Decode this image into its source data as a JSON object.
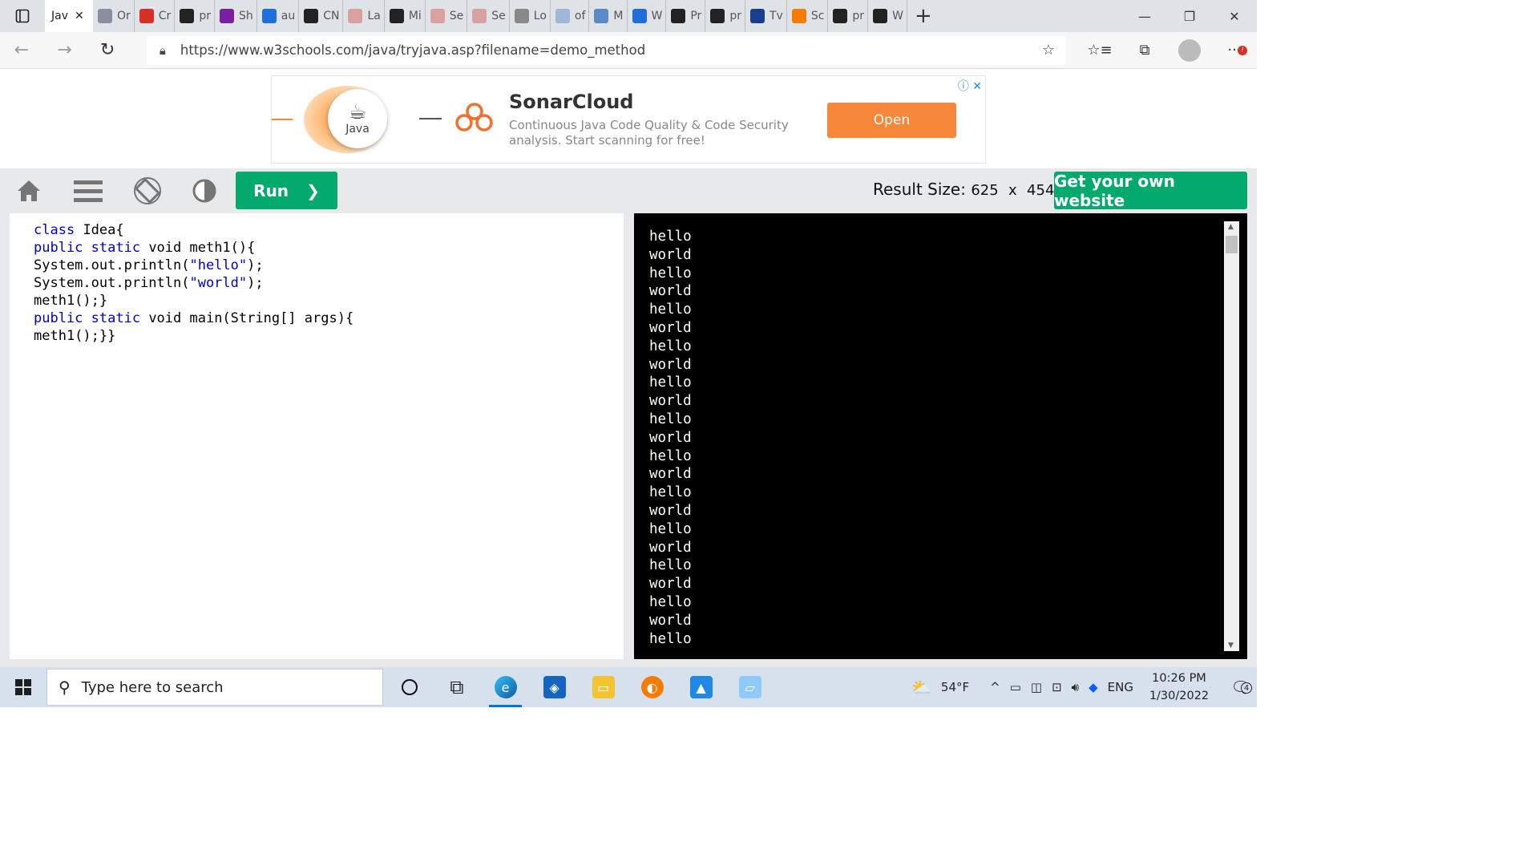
{
  "browser": {
    "active_tab": {
      "title": "Jav",
      "close": "✕"
    },
    "tabs": [
      {
        "label": "Or",
        "icon": "bolt-icon",
        "color": "#8a8fa0"
      },
      {
        "label": "Cr",
        "icon": "gmail-icon",
        "color": "#d93025"
      },
      {
        "label": "pr",
        "icon": "github-icon",
        "color": "#222222"
      },
      {
        "label": "Sh",
        "icon": "character-icon",
        "color": "#7b1fa2"
      },
      {
        "label": "au",
        "icon": "bing-icon",
        "color": "#1e6fd9"
      },
      {
        "label": "CN",
        "icon": "m-circle-icon",
        "color": "#222222"
      },
      {
        "label": "La",
        "icon": "pdf-icon",
        "color": "#d9a0a0"
      },
      {
        "label": "Mi",
        "icon": "doc-icon",
        "color": "#222222"
      },
      {
        "label": "Se",
        "icon": "pdf-icon",
        "color": "#d9a0a0"
      },
      {
        "label": "Se",
        "icon": "pdf-icon",
        "color": "#d9a0a0"
      },
      {
        "label": "Lo",
        "icon": "doc-icon",
        "color": "#888888"
      },
      {
        "label": "of",
        "icon": "bing-icon",
        "color": "#9fb8d8"
      },
      {
        "label": "M",
        "icon": "image-icon",
        "color": "#5a8ac8"
      },
      {
        "label": "W",
        "icon": "bing-icon",
        "color": "#1e6fd9"
      },
      {
        "label": "Pr",
        "icon": "github-icon",
        "color": "#222222"
      },
      {
        "label": "pr",
        "icon": "github-icon",
        "color": "#222222"
      },
      {
        "label": "Tv",
        "icon": "star-icon",
        "color": "#1a3e8c"
      },
      {
        "label": "Sc",
        "icon": "c-icon",
        "color": "#f57c00"
      },
      {
        "label": "pr",
        "icon": "github-icon",
        "color": "#222222"
      },
      {
        "label": "W",
        "icon": "github-icon",
        "color": "#222222"
      }
    ],
    "new_tab": "+",
    "url": "https://www.w3schools.com/java/tryjava.asp?filename=demo_method"
  },
  "ad": {
    "java_label": "Java",
    "brand": "SonarCloud",
    "description": "Continuous Java Code Quality & Code Security analysis. Start scanning for free!",
    "cta": "Open",
    "info_glyphs": "ⓘ ✕"
  },
  "toolbar": {
    "run_label": "Run",
    "result_size_label": "Result Size:",
    "result_width": "625",
    "result_x": "x",
    "result_height": "454",
    "get_site_label": "Get your own website"
  },
  "editor": {
    "lines": [
      "class Idea{",
      "public static void meth1(){",
      "System.out.println(\"hello\");",
      "System.out.println(\"world\");",
      "meth1();}",
      "public static void main(String[] args){",
      "meth1();}}"
    ]
  },
  "output": {
    "lines": [
      "hello",
      "world",
      "hello",
      "world",
      "hello",
      "world",
      "hello",
      "world",
      "hello",
      "world",
      "hello",
      "world",
      "hello",
      "world",
      "hello",
      "world",
      "hello",
      "world",
      "hello",
      "world",
      "hello",
      "world",
      "hello"
    ]
  },
  "taskbar": {
    "search_placeholder": "Type here to search",
    "weather": "54°F",
    "language": "ENG",
    "time": "10:26 PM",
    "date": "1/30/2022",
    "notifications": "4"
  }
}
